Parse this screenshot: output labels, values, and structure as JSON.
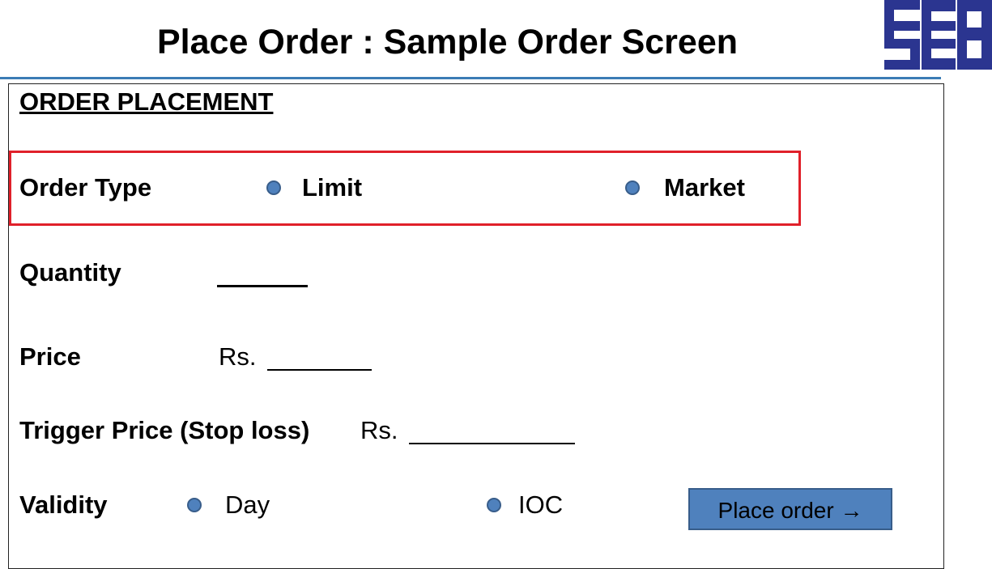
{
  "title": "Place Order : Sample Order Screen",
  "logo_text": "SEBI",
  "section_heading": "ORDER PLACEMENT",
  "order_type": {
    "label": "Order Type",
    "options": [
      "Limit",
      "Market"
    ]
  },
  "quantity": {
    "label": "Quantity",
    "value": ""
  },
  "price": {
    "label": "Price",
    "currency": "Rs.",
    "value": ""
  },
  "trigger_price": {
    "label": "Trigger Price (Stop loss)",
    "currency": "Rs.",
    "value": ""
  },
  "validity": {
    "label": "Validity",
    "options": [
      "Day",
      "IOC"
    ]
  },
  "place_order_button": "Place order →",
  "colors": {
    "accent": "#4f81bd",
    "accent_border": "#385d8a",
    "highlight": "#e0202a",
    "rule": "#3b7cb5",
    "logo": "#2b3590"
  },
  "icons": [
    "radio-button-icon",
    "sebi-logo"
  ]
}
